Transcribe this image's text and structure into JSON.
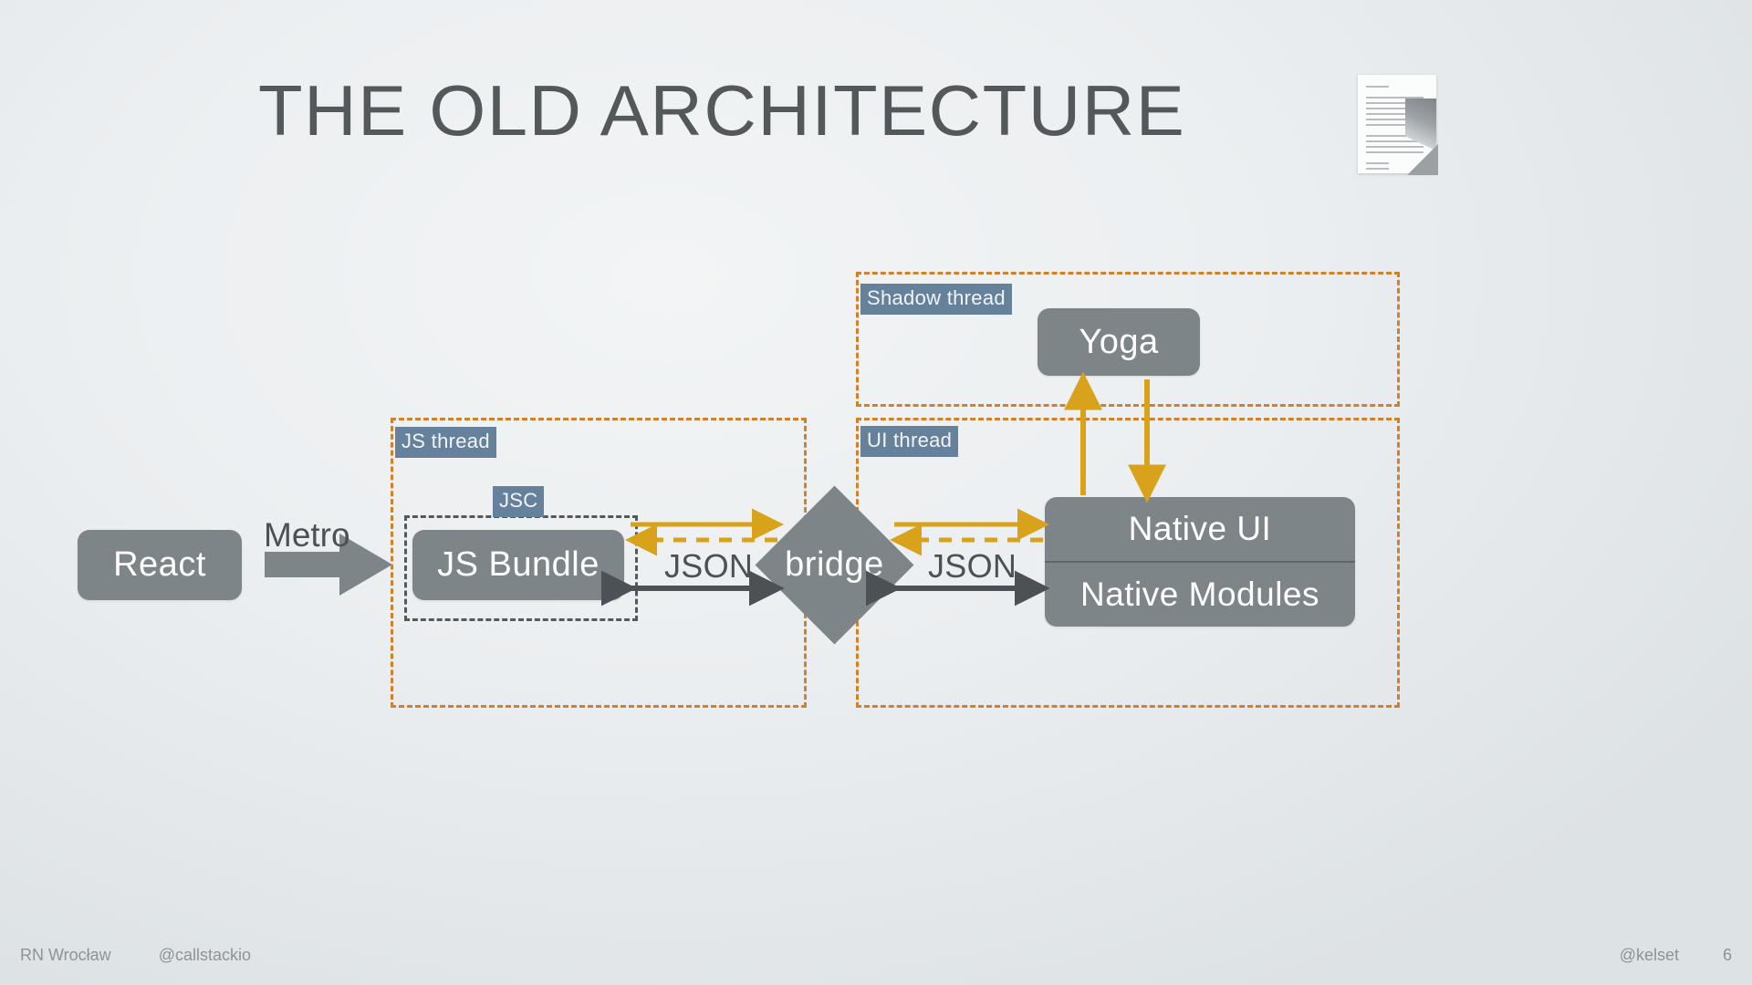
{
  "slide": {
    "title": "THE OLD ARCHITECTURE",
    "doc_icon": "document-page-curl-icon"
  },
  "diagram": {
    "nodes": [
      {
        "id": "react",
        "label": "React"
      },
      {
        "id": "js-bundle",
        "label": "JS Bundle"
      },
      {
        "id": "bridge",
        "label": "bridge"
      },
      {
        "id": "yoga",
        "label": "Yoga"
      },
      {
        "id": "native-ui",
        "label": "Native UI"
      },
      {
        "id": "native-modules",
        "label": "Native Modules"
      }
    ],
    "regions": [
      {
        "id": "js-thread",
        "label": "JS thread"
      },
      {
        "id": "ui-thread",
        "label": "UI thread"
      },
      {
        "id": "shadow-thread",
        "label": "Shadow thread"
      },
      {
        "id": "jsc",
        "label": "JSC"
      }
    ],
    "edges": [
      {
        "id": "metro",
        "label": "Metro"
      },
      {
        "id": "json-left",
        "label": "JSON"
      },
      {
        "id": "json-right",
        "label": "JSON"
      }
    ],
    "colors": {
      "node_fill": "#7e8588",
      "thread_border": "#d2802a",
      "thread_label_bg": "#66819c",
      "jsc_border": "#55595c",
      "gold_arrow": "#d9a21b",
      "dark_arrow": "#4b5154",
      "title_text": "#53585b",
      "background": "#eceff1"
    }
  },
  "footer": {
    "event": "RN Wrocław",
    "org_handle": "@callstackio",
    "author_handle": "@kelset",
    "page_number": "6"
  }
}
